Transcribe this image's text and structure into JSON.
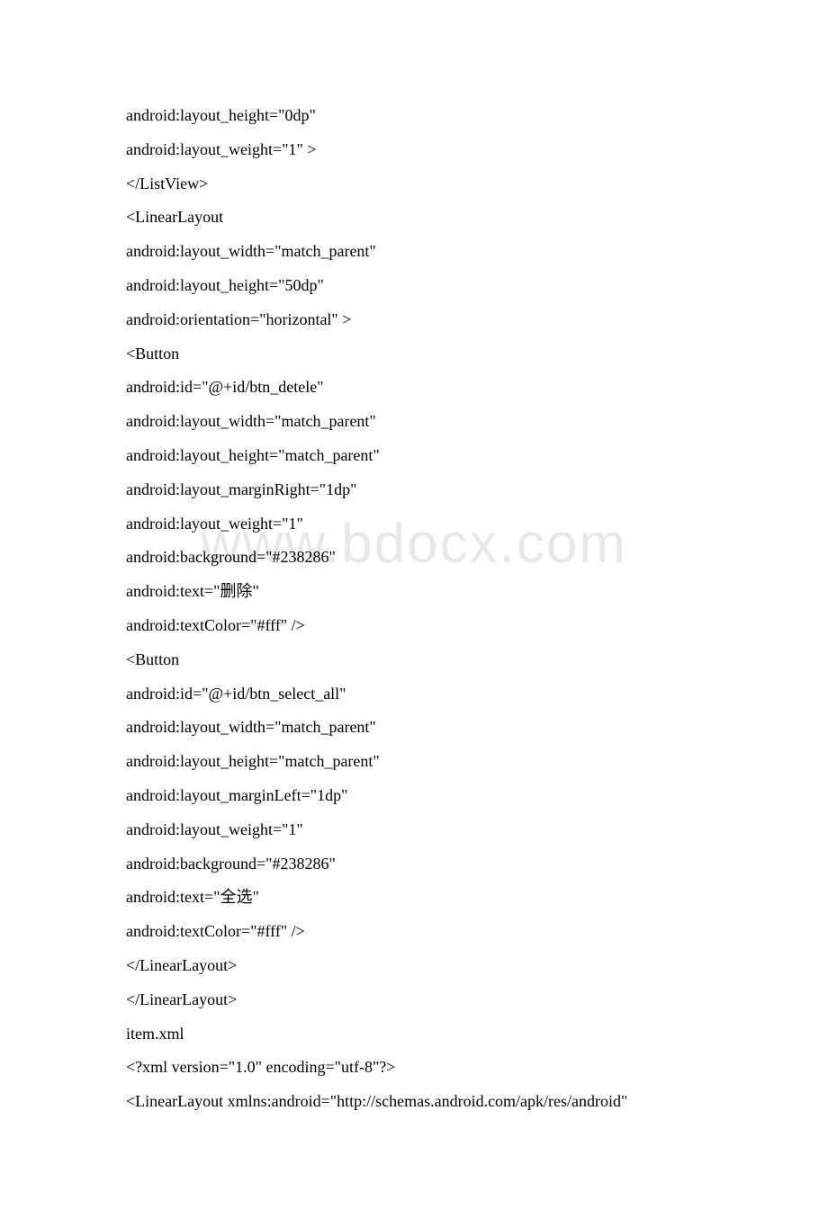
{
  "watermark": "www.bdocx.com",
  "lines": [
    "android:layout_height=\"0dp\"",
    "android:layout_weight=\"1\" >",
    "</ListView>",
    "<LinearLayout",
    "android:layout_width=\"match_parent\"",
    "android:layout_height=\"50dp\"",
    "android:orientation=\"horizontal\" >",
    "<Button",
    "android:id=\"@+id/btn_detele\"",
    "android:layout_width=\"match_parent\"",
    "android:layout_height=\"match_parent\"",
    "android:layout_marginRight=\"1dp\"",
    "android:layout_weight=\"1\"",
    "android:background=\"#238286\"",
    "android:text=\"删除\"",
    "android:textColor=\"#fff\" />",
    "<Button",
    "android:id=\"@+id/btn_select_all\"",
    "android:layout_width=\"match_parent\"",
    "android:layout_height=\"match_parent\"",
    "android:layout_marginLeft=\"1dp\"",
    "android:layout_weight=\"1\"",
    "android:background=\"#238286\"",
    "android:text=\"全选\"",
    "android:textColor=\"#fff\" />",
    "</LinearLayout>",
    "</LinearLayout>",
    "item.xml",
    "<?xml version=\"1.0\" encoding=\"utf-8\"?>",
    "<LinearLayout xmlns:android=\"http://schemas.android.com/apk/res/android\""
  ]
}
